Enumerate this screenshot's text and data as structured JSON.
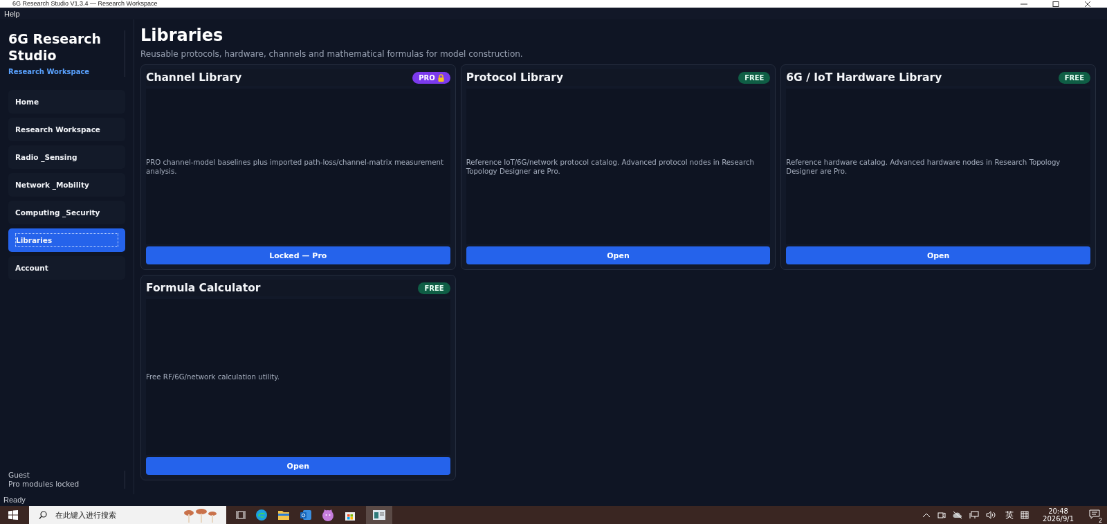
{
  "window": {
    "title": "6G Research Studio V1.3.4 — Research Workspace"
  },
  "menu": [
    "Help"
  ],
  "sidebar": {
    "app_name": "6G Research Studio",
    "subtitle": "Research Workspace",
    "items": [
      {
        "label": "Home",
        "selected": false
      },
      {
        "label": "Research Workspace",
        "selected": false
      },
      {
        "label": "Radio _Sensing",
        "selected": false
      },
      {
        "label": "Network _Mobility",
        "selected": false
      },
      {
        "label": "Computing _Security",
        "selected": false
      },
      {
        "label": "Libraries",
        "selected": true
      },
      {
        "label": "Account",
        "selected": false
      }
    ],
    "user": "Guest",
    "user_status": "Pro modules locked"
  },
  "page": {
    "title": "Libraries",
    "subtitle": "Reusable protocols, hardware, channels and mathematical formulas for model construction."
  },
  "cards": [
    {
      "title": "Channel Library",
      "badge": {
        "kind": "pro",
        "label": "PRO"
      },
      "description": "PRO channel-model baselines plus imported path-loss/channel-matrix measurement analysis.",
      "button": "Locked — Pro"
    },
    {
      "title": "Protocol Library",
      "badge": {
        "kind": "free",
        "label": "FREE"
      },
      "description": "Reference IoT/6G/network protocol catalog. Advanced protocol nodes in Research Topology Designer are Pro.",
      "button": "Open"
    },
    {
      "title": "6G / IoT Hardware Library",
      "badge": {
        "kind": "free",
        "label": "FREE"
      },
      "description": "Reference hardware catalog. Advanced hardware nodes in Research Topology Designer are Pro.",
      "button": "Open"
    },
    {
      "title": "Formula Calculator",
      "badge": {
        "kind": "free",
        "label": "FREE"
      },
      "description": "Free RF/6G/network calculation utility.",
      "button": "Open"
    }
  ],
  "status_bar": "Ready",
  "taskbar": {
    "search_placeholder": "在此键入进行搜索",
    "ime": "英",
    "time": "20:48",
    "date": "2026/9/1",
    "notifications": "2"
  }
}
